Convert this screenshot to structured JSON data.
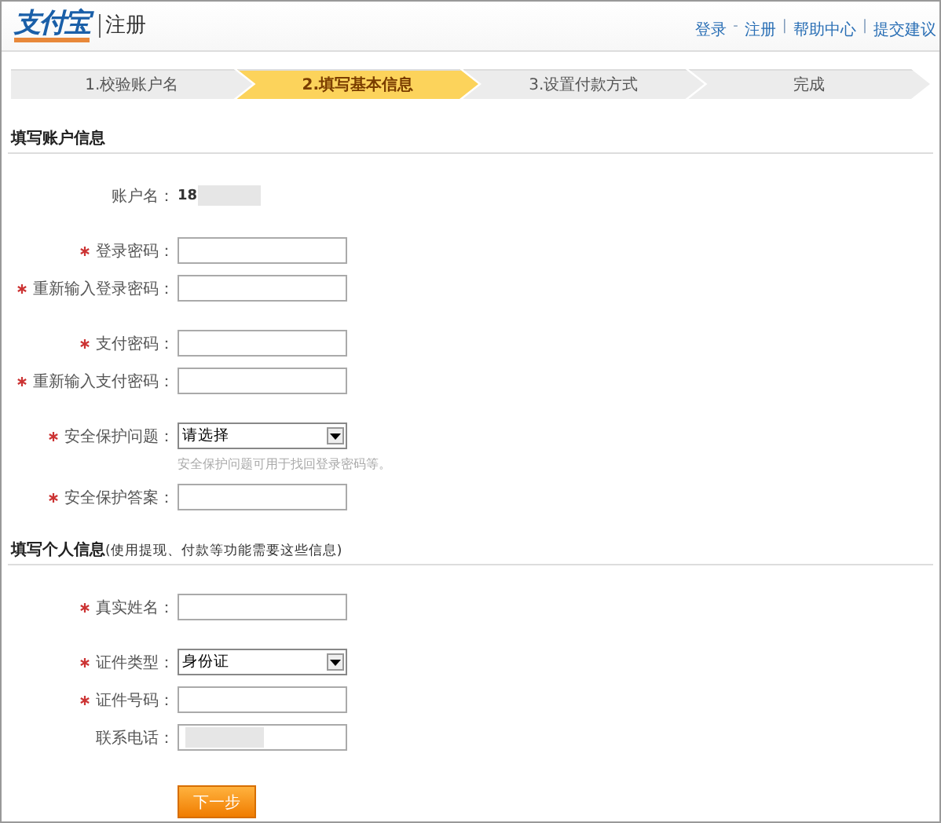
{
  "header": {
    "logo": "支付宝",
    "title": "注册",
    "links": [
      {
        "kind": "link",
        "text": "登录"
      },
      {
        "kind": "separator",
        "text": "-"
      },
      {
        "kind": "link",
        "text": "注册"
      },
      {
        "kind": "separator",
        "text": "|"
      },
      {
        "kind": "link",
        "text": "帮助中心"
      },
      {
        "kind": "separator",
        "text": "|"
      },
      {
        "kind": "link",
        "text": "提交建议"
      }
    ]
  },
  "steps": [
    {
      "label": "1.校验账户名",
      "selected": false
    },
    {
      "label": "2.填写基本信息",
      "selected": true
    },
    {
      "label": "3.设置付款方式",
      "selected": false
    },
    {
      "label": "完成",
      "selected": false
    }
  ],
  "sections": [
    {
      "title": "填写账户信息",
      "groups": [
        [
          {
            "kind": "static",
            "label": "账户名：",
            "value": "18",
            "redacted": true,
            "required": false
          }
        ],
        [
          {
            "kind": "text",
            "label": "登录密码：",
            "required": true
          },
          {
            "kind": "text",
            "label": "重新输入登录密码：",
            "required": true
          }
        ],
        [
          {
            "kind": "text",
            "label": "支付密码：",
            "required": true
          },
          {
            "kind": "text",
            "label": "重新输入支付密码：",
            "required": true
          }
        ],
        [
          {
            "kind": "select",
            "label": "安全保护问题：",
            "value": "请选择",
            "required": true,
            "hint": "安全保护问题可用于找回登录密码等。"
          },
          {
            "kind": "text",
            "label": "安全保护答案：",
            "required": true
          }
        ]
      ]
    },
    {
      "title": "填写个人信息",
      "note": "(使用提现、付款等功能需要这些信息)",
      "groups": [
        [
          {
            "kind": "text",
            "label": "真实姓名：",
            "required": true
          }
        ],
        [
          {
            "kind": "select",
            "label": "证件类型：",
            "value": "身份证",
            "required": true
          },
          {
            "kind": "text",
            "label": "证件号码：",
            "required": true
          },
          {
            "kind": "text",
            "label": "联系电话：",
            "required": false,
            "redacted": true
          }
        ]
      ]
    }
  ],
  "button": "下一步"
}
